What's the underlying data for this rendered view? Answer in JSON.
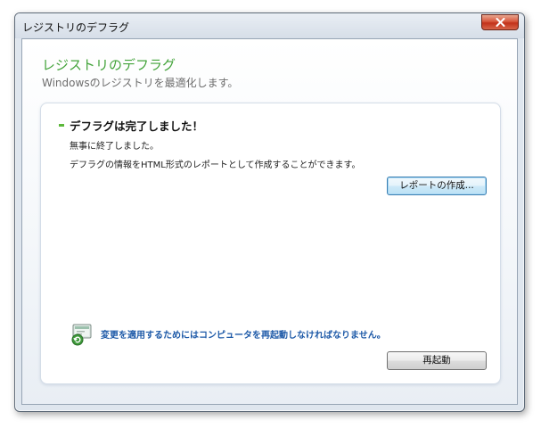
{
  "window": {
    "title": "レジストリのデフラグ"
  },
  "header": {
    "title": "レジストリのデフラグ",
    "subtitle": "Windowsのレジストリを最適化します。"
  },
  "status": {
    "heading": "デフラグは完了しました！",
    "message": "無事に終了しました。",
    "report_description": "デフラグの情報をHTML形式のレポートとして作成することができます。"
  },
  "buttons": {
    "create_report": "レポートの作成...",
    "restart": "再起動"
  },
  "notice": {
    "text": "変更を適用するためにはコンピュータを再起動しなければなりません。"
  },
  "colors": {
    "accent_green": "#43a33a",
    "notice_blue": "#1e5aa8",
    "close_red": "#c2321a"
  },
  "icons": {
    "close": "close-icon",
    "notice": "computer-restart-icon"
  }
}
